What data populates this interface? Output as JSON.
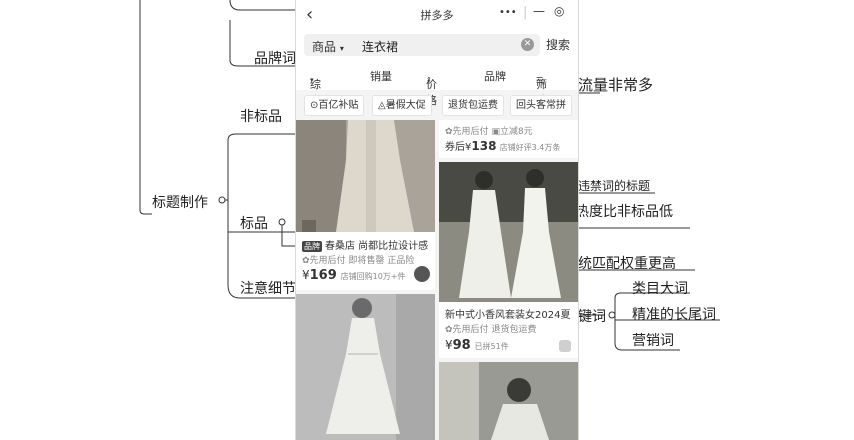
{
  "mindmap": {
    "brand_words": "品牌词",
    "traffic_note": "流量非常多",
    "non_standard": "非标品",
    "title_making": "标题制作",
    "forbidden_words_note": "违禁词的标题",
    "heat_note": "热度比非标品低",
    "standard": "标品",
    "matching_note": "统匹配权重更高",
    "details": "注意细节",
    "keywords": "键词",
    "category_words": "类目大词",
    "long_tail_words": "精准的长尾词",
    "marketing_words": "营销词"
  },
  "app": {
    "title": "拼多多",
    "capsule": {
      "more": "•••",
      "minimize": "—",
      "close": "◎"
    },
    "search": {
      "category": "商品",
      "query": "连衣裙",
      "button": "搜索"
    },
    "filters": [
      "综合",
      "销量",
      "价格",
      "品牌",
      "筛选"
    ],
    "chips": [
      "百亿补贴",
      "暑假大促",
      "退货包运费",
      "回头客常拼"
    ],
    "products": {
      "left1": {
        "tag": "品牌",
        "title": "春桑店 尚都比拉设计感",
        "service1": "先用后付",
        "service2": "即将售罄",
        "service3": "正品险",
        "currency": "¥",
        "price": "169",
        "sales": "店铺回购10万+件"
      },
      "right1": {
        "service1": "先用后付",
        "service2": "立减8元",
        "coupon_label": "券后",
        "currency": "¥",
        "price": "138",
        "sales": "店铺好评3.4万条"
      },
      "right2": {
        "title": "新中式小香风套装女2024夏",
        "service1": "先用后付",
        "service2": "退货包运费",
        "currency": "¥",
        "price": "98",
        "sales": "已拼51件"
      }
    }
  },
  "colors": {
    "accent": "#e02e24",
    "line": "#333333"
  }
}
